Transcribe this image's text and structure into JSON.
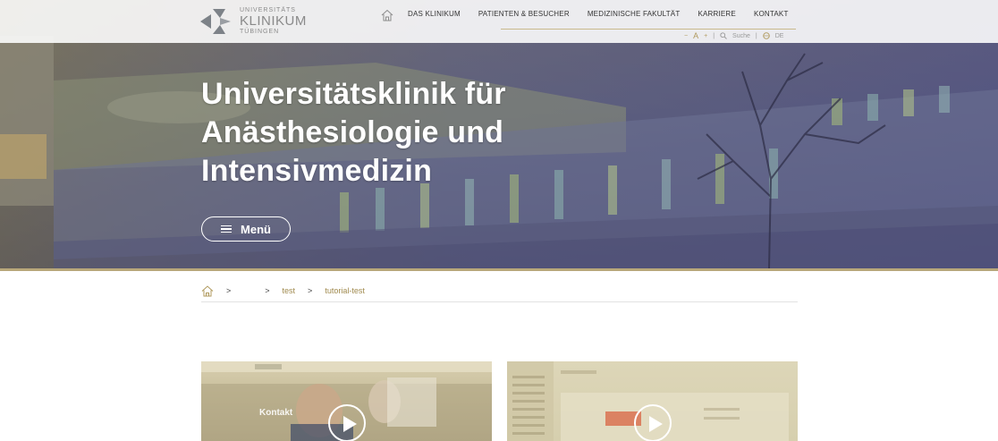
{
  "header": {
    "logo": {
      "line1": "UNIVERSITÄTS",
      "line2": "KLINIKUM",
      "line3": "TÜBINGEN"
    },
    "nav": [
      {
        "label": "DAS KLINIKUM"
      },
      {
        "label": "PATIENTEN & BESUCHER"
      },
      {
        "label": "MEDIZINISCHE FAKULTÄT"
      },
      {
        "label": "KARRIERE"
      },
      {
        "label": "KONTAKT"
      }
    ],
    "utility": {
      "font_smaller": "−",
      "font_label": "A",
      "font_larger": "+",
      "search_label": "Suche",
      "language": "DE"
    }
  },
  "hero": {
    "title": "Universitätsklinik für Anästhesiologie und Intensivmedizin",
    "menu_label": "Menü"
  },
  "breadcrumb": {
    "items": [
      {
        "label": ""
      },
      {
        "label": "test"
      },
      {
        "label": "tutorial-test"
      }
    ],
    "separator": ">"
  },
  "videos": [
    {
      "overlay_text": "Kontakt"
    },
    {
      "overlay_text": ""
    }
  ],
  "colors": {
    "accent_gold": "#b09a5e",
    "hero_overlay": "#4a4c70",
    "white": "#ffffff"
  }
}
